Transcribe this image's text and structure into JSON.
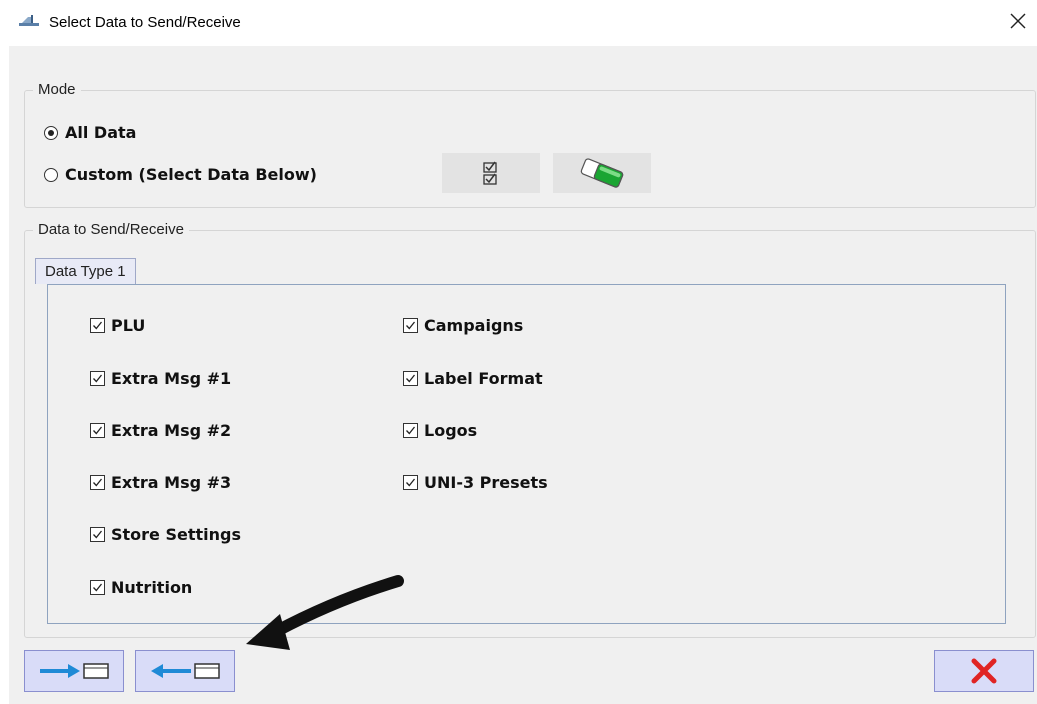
{
  "window": {
    "title": "Select Data to Send/Receive"
  },
  "mode": {
    "legend": "Mode",
    "options": [
      {
        "label": "All Data",
        "selected": true
      },
      {
        "label": "Custom (Select Data Below)",
        "selected": false
      }
    ]
  },
  "data_section": {
    "legend": "Data to Send/Receive",
    "tab_label": "Data Type 1",
    "left_column": [
      {
        "label": "PLU",
        "checked": true
      },
      {
        "label": "Extra Msg #1",
        "checked": true
      },
      {
        "label": "Extra Msg #2",
        "checked": true
      },
      {
        "label": "Extra Msg #3",
        "checked": true
      },
      {
        "label": "Store Settings",
        "checked": true
      },
      {
        "label": "Nutrition",
        "checked": true
      }
    ],
    "right_column": [
      {
        "label": "Campaigns",
        "checked": true
      },
      {
        "label": "Label Format",
        "checked": true
      },
      {
        "label": "Logos",
        "checked": true
      },
      {
        "label": "UNI-3 Presets",
        "checked": true
      }
    ]
  },
  "icons": {
    "select_all": "check-all-icon",
    "clear": "eraser-icon",
    "send": "send-arrow-icon",
    "receive": "receive-arrow-icon",
    "cancel": "red-x-icon",
    "annotation": "annotation-arrow"
  },
  "colors": {
    "arrow_blue": "#1f8ad6",
    "cancel_red": "#e02424",
    "eraser_green": "#1aa532",
    "button_bg": "#d9dcf8"
  }
}
